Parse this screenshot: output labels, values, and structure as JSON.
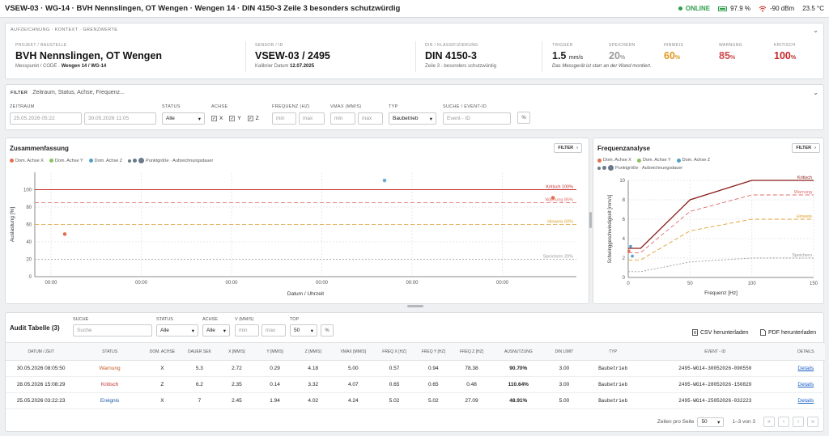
{
  "topbar": {
    "title": "VSEW-03 · WG-14 · BVH Nennslingen, OT Wengen · Wengen 14 · DIN 4150-3 Zeile 3 besonders schutzwürdig",
    "online": "ONLINE",
    "battery": "97.9 %",
    "signal": "-90 dBm",
    "temp": "23.5 °C"
  },
  "context": {
    "header": "AUFZEICHNUNG · KONTEXT · GRENZWERTE",
    "project": {
      "label": "PROJEKT / BAUSTELLE",
      "value": "BVH Nennslingen, OT Wengen",
      "sub_prefix": "Messpunkt / CODE ·",
      "sub_bold": "Wengen 14 / WG-14"
    },
    "sensor": {
      "label": "SENSOR / ID",
      "value": "VSEW-03 / 2495",
      "sub_prefix": "Kalibrier Datum",
      "sub_bold": "12.07.2025"
    },
    "din": {
      "label": "DIN / KLASSIFIZIERUNG",
      "value": "DIN 4150-3",
      "sub": "Zeile 3 - besonders schutzwürdig"
    },
    "trigger": {
      "label": "TRIGGER",
      "value": "1.5",
      "unit": "mm/s"
    },
    "speichern": {
      "label": "SPEICHERN",
      "value": "20",
      "unit": "%"
    },
    "hinweis": {
      "label": "HINWEIS",
      "value": "60",
      "unit": "%"
    },
    "warnung": {
      "label": "WARNUNG",
      "value": "85",
      "unit": "%"
    },
    "kritisch": {
      "label": "KRITISCH",
      "value": "100",
      "unit": "%"
    },
    "note": "Das Messgerät ist starr an der Wand montiert.",
    "colors": {
      "speichern": "#9a9a9a",
      "hinweis": "#e09a1e",
      "warnung": "#d04848",
      "kritisch": "#c42a2a"
    }
  },
  "filter": {
    "label": "FILTER",
    "placeholder": "Zeitraum, Status, Achse, Frequenz...",
    "zeitraum": {
      "label": "ZEITRAUM",
      "from": "25.05.2026 05:22",
      "to": "30.05.2026 11:05"
    },
    "status": {
      "label": "STATUS",
      "value": "Alle"
    },
    "achse": {
      "label": "ACHSE",
      "x": "X",
      "y": "Y",
      "z": "Z"
    },
    "freq": {
      "label": "FREQUENZ (HZ)",
      "min": "min",
      "max": "max"
    },
    "vmax": {
      "label": "VMAX (MM/S)",
      "min": "min",
      "max": "max"
    },
    "typ": {
      "label": "TYP",
      "value": "Baubetrieb"
    },
    "suche": {
      "label": "SUCHE / EVENT-ID",
      "placeholder": "Event - ID"
    },
    "pct": "%"
  },
  "summary": {
    "title": "Zusammenfassung",
    "filter_btn": "FILTER",
    "legend": [
      "Dom. Achse X",
      "Dom. Achse Y",
      "Dom. Achse Z",
      "Punktgröße · Aufzeichnungsdauer"
    ]
  },
  "freqpanel": {
    "title": "Frequenzanalyse",
    "filter_btn": "FILTER",
    "legend": [
      "Dom. Achse X",
      "Dom. Achse Y",
      "Dom. Achse Z",
      "Punktgröße · Aufzeichnungsdauer"
    ]
  },
  "chart_data": [
    {
      "type": "scatter",
      "xlabel": "Datum / Uhrzeit",
      "ylabel": "Auslastung [%]",
      "ylim": [
        0,
        120
      ],
      "yticks": [
        0,
        20,
        40,
        60,
        80,
        100
      ],
      "xticks": [
        "00:00",
        "00:00",
        "00:00",
        "00:00",
        "00:00",
        "00:00"
      ],
      "thresholds": [
        {
          "name": "Kritisch 100%",
          "value": 100
        },
        {
          "name": "Warnung 85%",
          "value": 85
        },
        {
          "name": "Hinweis 60%",
          "value": 60
        },
        {
          "name": "Speichern 20%",
          "value": 20
        }
      ],
      "points": [
        {
          "axis": "X",
          "x": "25.05.2026 03:22:23",
          "y": 48.91
        },
        {
          "axis": "Z",
          "x": "28.05.2026 15:08:29",
          "y": 110.64
        },
        {
          "axis": "X",
          "x": "30.05.2026 08:05:50",
          "y": 90.7
        }
      ],
      "grid": true
    },
    {
      "type": "line",
      "xlabel": "Frequenz [Hz]",
      "ylabel": "Schwinggeschwindigkeit [mm/s]",
      "xlim": [
        0,
        150
      ],
      "ylim": [
        0,
        10
      ],
      "xticks": [
        0,
        50,
        100,
        150
      ],
      "yticks": [
        0,
        2,
        4,
        6,
        8,
        10
      ],
      "series": [
        {
          "name": "Kritisch",
          "x": [
            0,
            10,
            50,
            100,
            150
          ],
          "y": [
            3,
            3,
            8,
            10,
            10
          ]
        },
        {
          "name": "Warnung",
          "x": [
            0,
            10,
            50,
            100,
            150
          ],
          "y": [
            2.55,
            2.55,
            6.8,
            8.5,
            8.5
          ]
        },
        {
          "name": "Hinweis",
          "x": [
            0,
            10,
            50,
            100,
            150
          ],
          "y": [
            1.8,
            1.8,
            4.8,
            6,
            6
          ]
        },
        {
          "name": "Speichern",
          "x": [
            0,
            10,
            50,
            100,
            150
          ],
          "y": [
            0.6,
            0.6,
            1.6,
            2,
            2
          ]
        }
      ],
      "points": [
        {
          "axis": "X",
          "x": 0.57,
          "y": 2.72
        },
        {
          "axis": "Z",
          "x": 3.32,
          "y": 2.2
        },
        {
          "axis": "Z",
          "x": 1.94,
          "y": 3.2
        }
      ],
      "grid": true
    }
  ],
  "audit": {
    "title": "Audit Tabelle (3)",
    "suche": {
      "label": "SUCHE",
      "placeholder": "Suche"
    },
    "status": {
      "label": "STATUS",
      "value": "Alle"
    },
    "achse": {
      "label": "ACHSE",
      "value": "Alle"
    },
    "v": {
      "label": "V (MM/S)",
      "min": "min",
      "max": "max"
    },
    "top": {
      "label": "TOP",
      "value": "50"
    },
    "pct": "%",
    "csv": "CSV herunterladen",
    "pdf": "PDF herunterladen",
    "columns": [
      "DATUM / ZEIT",
      "STATUS",
      "DOM. ACHSE",
      "DAUER SEK",
      "X [MM/S]",
      "Y [MM/S]",
      "Z [MM/S]",
      "VMAX [MM/S]",
      "FREQ X [HZ]",
      "FREQ Y [HZ]",
      "FREQ Z [HZ]",
      "AUSNUTZUNG",
      "DIN LIMIT",
      "TYP",
      "EVENT - ID",
      "DETAILS"
    ],
    "rows": [
      {
        "date": "30.05.2026 08:05:50",
        "status": "Warnung",
        "cls": "st-w",
        "axis": "X",
        "dur": "5.3",
        "x": "2.72",
        "y": "0.29",
        "z": "4.18",
        "vmax": "5.00",
        "fx": "0.57",
        "fy": "0.94",
        "fz": "78.38",
        "aus": "90.70%",
        "din": "3.00",
        "typ": "Baubetrieb",
        "id": "2495-WG14-30052026-090550",
        "det": "Details"
      },
      {
        "date": "28.05.2026 15:08:29",
        "status": "Kritisch",
        "cls": "st-k",
        "axis": "Z",
        "dur": "6.2",
        "x": "2.35",
        "y": "0.14",
        "z": "3.32",
        "vmax": "4.07",
        "fx": "0.65",
        "fy": "0.65",
        "fz": "0.48",
        "aus": "110.64%",
        "din": "3.00",
        "typ": "Baubetrieb",
        "id": "2495-WG14-28052026-150829",
        "det": "Details"
      },
      {
        "date": "25.05.2026 03:22:23",
        "status": "Ereignis",
        "cls": "st-e",
        "axis": "X",
        "dur": "7",
        "x": "2.45",
        "y": "1.94",
        "z": "4.02",
        "vmax": "4.24",
        "fx": "5.02",
        "fy": "5.02",
        "fz": "27.09",
        "aus": "48.91%",
        "din": "5.00",
        "typ": "Baubetrieb",
        "id": "2495-WG14-25052026-032223",
        "det": "Details"
      }
    ],
    "pager": {
      "label": "Zeilen pro Seite",
      "value": "50",
      "range": "1–3 von 3"
    }
  },
  "colors": {
    "axisX": "#e07050",
    "axisY": "#8cc060",
    "axisZ": "#50a0c8",
    "size": "#6a7a8a"
  }
}
